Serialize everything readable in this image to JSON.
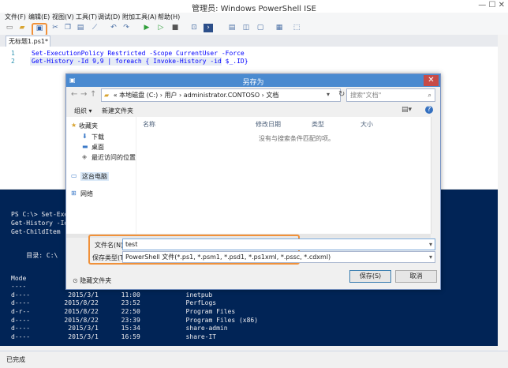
{
  "window": {
    "title": "管理员: Windows PowerShell ISE",
    "controls": "—  ☐  ✕"
  },
  "menubar": [
    "文件(F)",
    "编辑(E)",
    "视图(V)",
    "工具(T)",
    "调试(D)",
    "附加工具(A)",
    "帮助(H)"
  ],
  "toolbar_icons": [
    "new-icon",
    "open-icon",
    "save-icon",
    "cut-icon",
    "copy-icon",
    "paste-icon",
    "clear-icon",
    "undo-icon",
    "redo-icon",
    "run-icon",
    "run-selection-icon",
    "stop-icon",
    "remote-icon",
    "console-icon",
    "layout-top-icon",
    "layout-right-icon",
    "layout-max-icon",
    "show-script-icon",
    "commands-icon"
  ],
  "script_tab": "无标题1.ps1*",
  "editor": {
    "lines": [
      {
        "num": "1",
        "code": "Set-ExecutionPolicy Restricted -Scope CurrentUser -Force"
      },
      {
        "num": "2",
        "code": "Get-History -Id 9,9 | foreach { Invoke-History -id $_.ID}"
      }
    ]
  },
  "console": {
    "lines": [
      "PS C:\\> Set-Execu",
      "Get-History -Id 9",
      "Get-ChildItem",
      "",
      "    目录: C:\\",
      "",
      "",
      "Mode",
      "----",
      "d----          2015/3/1      11:00            inetpub",
      "d----         2015/8/22      23:52            PerfLogs",
      "d-r--         2015/8/22      22:50            Program Files",
      "d----         2015/8/22      23:39            Program Files (x86)",
      "d----          2015/3/1      15:34            share-admin",
      "d----          2015/3/1      16:59            share-IT"
    ]
  },
  "status": "已完成",
  "dialog": {
    "title": "另存为",
    "address": "«  本地磁盘 (C:)  ›  用户  ›  administrator.CONTOSO  ›  文档",
    "search_placeholder": "搜索\"文档\"",
    "organize": "组织 ▾",
    "new_folder": "新建文件夹",
    "nav_items": [
      "收藏夹",
      "下载",
      "桌面",
      "最近访问的位置",
      "这台电脑",
      "网络"
    ],
    "columns": [
      "名称",
      "修改日期",
      "类型",
      "大小"
    ],
    "empty_message": "没有与搜索条件匹配的项。",
    "filename_label": "文件名(N):",
    "filename_value": "test",
    "filetype_label": "保存类型(T):",
    "filetype_value": "PowerShell 文件(*.ps1, *.psm1, *.psd1, *.ps1xml, *.pssc, *.cdxml)",
    "hide_folders": "隐藏文件夹",
    "save_button": "保存(S)",
    "cancel_button": "取消"
  }
}
